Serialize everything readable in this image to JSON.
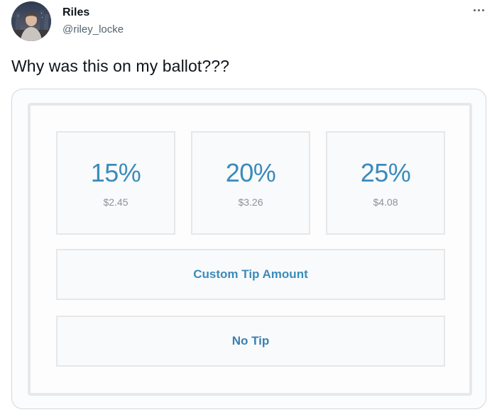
{
  "user": {
    "name": "Riles",
    "handle": "@riley_locke"
  },
  "tweet": {
    "text": "Why was this on my ballot???"
  },
  "tip_screen": {
    "options": [
      {
        "percent": "15%",
        "amount": "$2.45"
      },
      {
        "percent": "20%",
        "amount": "$3.26"
      },
      {
        "percent": "25%",
        "amount": "$4.08"
      }
    ],
    "custom_label": "Custom Tip Amount",
    "no_tip_label": "No Tip"
  },
  "colors": {
    "accent": "#3a8bbb",
    "text_primary": "#0f1419",
    "text_secondary": "#536471",
    "border": "#cfd9de"
  },
  "icons": {
    "more": "more-horizontal-icon"
  }
}
